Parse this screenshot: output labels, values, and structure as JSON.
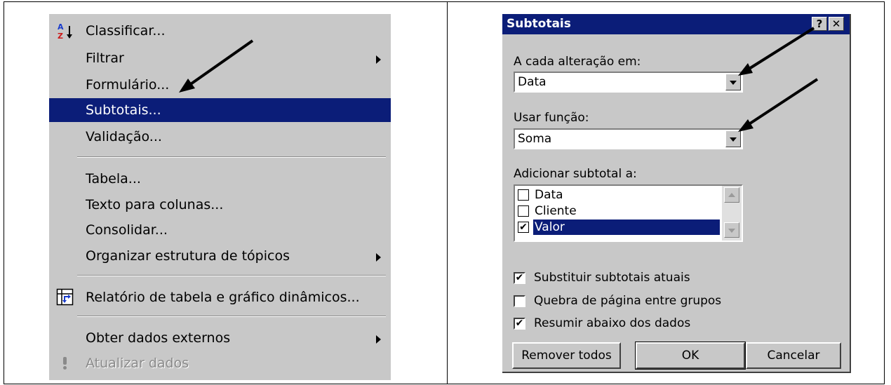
{
  "menu": {
    "items": [
      {
        "label": "Classificar...",
        "icon": "sort-az-icon"
      },
      {
        "label": "Filtrar",
        "submenu": true
      },
      {
        "label": "Formulário..."
      },
      {
        "label": "Subtotais...",
        "highlighted": true
      },
      {
        "label": "Validação..."
      },
      {
        "label": "Tabela..."
      },
      {
        "label": "Texto para colunas..."
      },
      {
        "label": "Consolidar..."
      },
      {
        "label": "Organizar estrutura de tópicos",
        "submenu": true
      },
      {
        "label": "Relatório de tabela e gráfico dinâmicos...",
        "icon": "pivot-table-icon"
      },
      {
        "label": "Obter dados externos",
        "submenu": true
      },
      {
        "label": "Atualizar dados",
        "disabled": true,
        "icon": "exclamation-icon"
      }
    ]
  },
  "dialog": {
    "title": "Subtotais",
    "help_glyph": "?",
    "close_glyph": "✕",
    "change_label": "A cada alteração em:",
    "change_value": "Data",
    "function_label": "Usar função:",
    "function_value": "Soma",
    "add_label": "Adicionar subtotal a:",
    "fields": [
      {
        "label": "Data",
        "checked": false
      },
      {
        "label": "Cliente",
        "checked": false
      },
      {
        "label": "Valor",
        "checked": true,
        "selected": true
      }
    ],
    "options": [
      {
        "label": "Substituir subtotais atuais",
        "checked": true
      },
      {
        "label": "Quebra de página entre grupos",
        "checked": false
      },
      {
        "label": "Resumir abaixo dos dados",
        "checked": true
      }
    ],
    "buttons": {
      "remove_all": "Remover todos",
      "ok": "OK",
      "cancel": "Cancelar"
    },
    "check_glyph": "✔"
  },
  "colors": {
    "highlight": "#0b1d78",
    "face": "#c8c8c8"
  }
}
